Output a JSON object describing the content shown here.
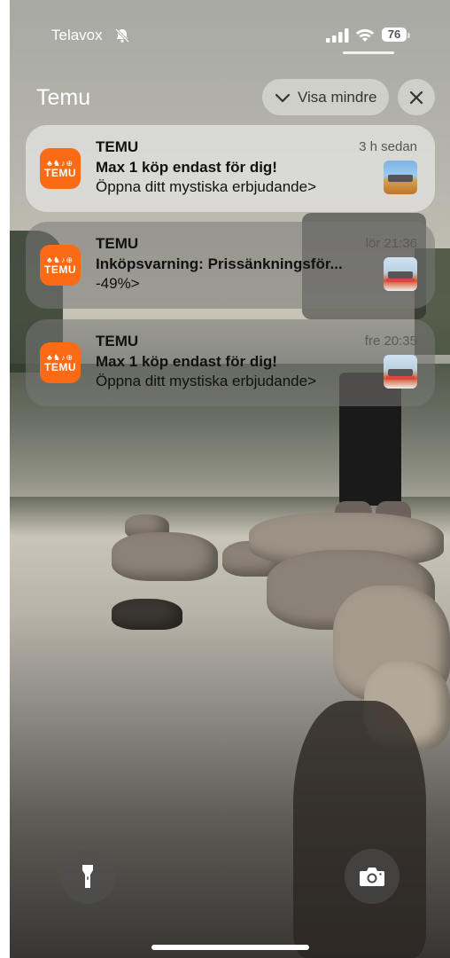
{
  "status_bar": {
    "carrier": "Telavox",
    "battery": "76",
    "icons": [
      "bell-slash-icon",
      "signal-icon",
      "wifi-icon",
      "battery-icon"
    ]
  },
  "group": {
    "title": "Temu",
    "show_less_label": "Visa mindre"
  },
  "notifications": [
    {
      "app": "TEMU",
      "time": "3 h sedan",
      "title": "Max 1 köp endast för dig!",
      "body": "Öppna ditt mystiska erbjudande>"
    },
    {
      "app": "TEMU",
      "time": "lör 21:36",
      "title": "Inköpsvarning: Prissänkningsför...",
      "body": "-49%>"
    },
    {
      "app": "TEMU",
      "time": "fre 20:35",
      "title": "Max 1 köp endast för dig!",
      "body": "Öppna ditt mystiska erbjudande>"
    }
  ],
  "app_icon": {
    "glyphs": "♣♞♪⊕",
    "word": "TEMU",
    "color": "#fb6a14"
  },
  "bottom": {
    "left_icon": "flashlight-icon",
    "right_icon": "camera-icon"
  }
}
